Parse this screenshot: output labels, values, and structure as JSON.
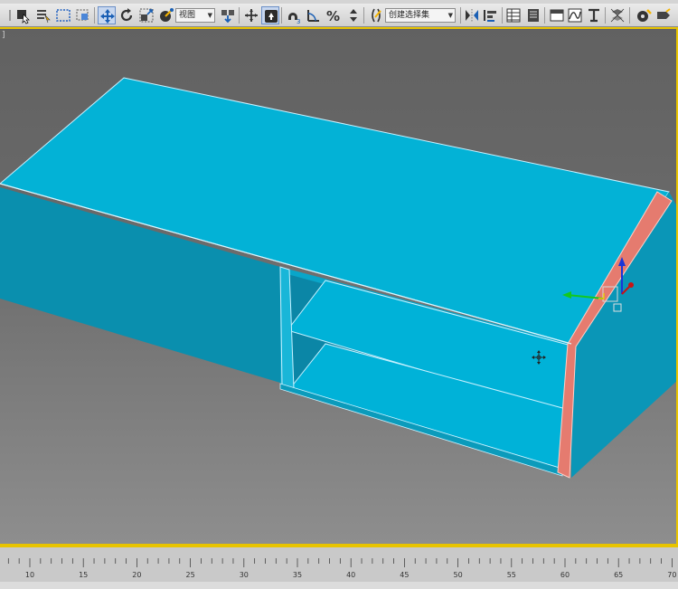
{
  "toolbar": {
    "view_dropdown": "视图",
    "selection_set_dropdown": "创建选择集"
  },
  "icons": [
    "select-object-icon",
    "select-by-name-icon",
    "rect-selection-icon",
    "window-crossing-icon",
    "move-icon",
    "rotate-icon",
    "scale-icon",
    "reference-coordinate-icon",
    "pivot-icon",
    "manipulate-icon",
    "keyboard-shortcut-icon",
    "snap-icon",
    "angle-snap-icon",
    "percent-snap-icon",
    "spinner-snap-icon",
    "edit-named-selection-icon",
    "mirror-icon",
    "align-icon",
    "scene-explorer-icon",
    "layer-manager-icon",
    "ribbon-icon",
    "curve-editor-icon",
    "schematic-view-icon",
    "material-editor-icon",
    "render-setup-icon",
    "render-icon"
  ],
  "viewport": {
    "label": "]"
  },
  "ruler": {
    "ticks": [
      "10",
      "15",
      "20",
      "25",
      "30",
      "35",
      "40",
      "45",
      "50",
      "55",
      "60",
      "65",
      "70"
    ]
  },
  "colors": {
    "model": "#00aed4",
    "selected_face": "#e57b6f",
    "viewport_border": "#e8c400"
  }
}
